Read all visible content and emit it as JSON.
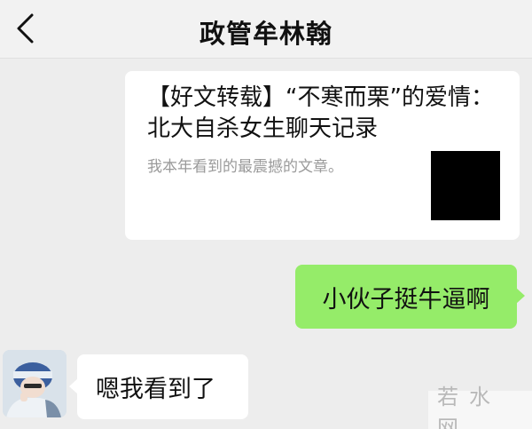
{
  "header": {
    "back_icon": "chevron-left-icon",
    "title": "政管牟林翰"
  },
  "messages": {
    "shared_article": {
      "title": "【好文转载】“不寒而栗”的爱情：北大自杀女生聊天记录",
      "description": "我本年看到的最震撼的文章。",
      "thumbnail_color": "#000000"
    },
    "outgoing_text": "小伙子挺牛逼啊",
    "incoming_text": "嗯我看到了"
  },
  "colors": {
    "background": "#ededed",
    "outgoing_bubble": "#95ec69",
    "incoming_bubble": "#ffffff"
  },
  "watermark": {
    "text": "若水网"
  }
}
